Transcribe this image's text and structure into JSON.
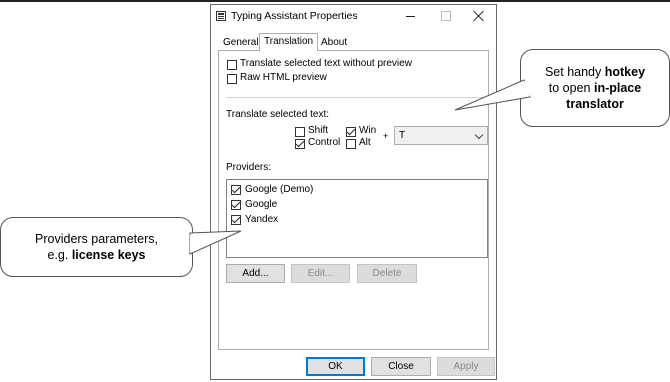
{
  "window": {
    "title": "Typing Assistant Properties",
    "tabs": [
      {
        "label": "General",
        "active": false
      },
      {
        "label": "Translation",
        "active": true
      },
      {
        "label": "About",
        "active": false
      }
    ]
  },
  "options": {
    "translate_without_preview": {
      "label": "Translate selected text without preview",
      "checked": false
    },
    "raw_html_preview": {
      "label": "Raw HTML preview",
      "checked": false
    }
  },
  "hotkey": {
    "section_label": "Translate selected text:",
    "modifiers": [
      {
        "label": "Shift",
        "checked": false
      },
      {
        "label": "Win",
        "checked": true
      },
      {
        "label": "Control",
        "checked": true
      },
      {
        "label": "Alt",
        "checked": false
      }
    ],
    "plus": "+",
    "key_value": "T"
  },
  "providers": {
    "section_label": "Providers:",
    "items": [
      {
        "label": "Google (Demo)",
        "checked": true
      },
      {
        "label": "Google",
        "checked": true
      },
      {
        "label": "Yandex",
        "checked": true
      }
    ],
    "buttons": {
      "add": "Add...",
      "edit": "Edit...",
      "delete": "Delete"
    }
  },
  "footer": {
    "ok": "OK",
    "close": "Close",
    "apply": "Apply"
  },
  "callouts": {
    "hotkey": {
      "line1_pre": "Set handy ",
      "line1_bold": "hotkey",
      "line2_pre": "to open ",
      "line2_bold": "in-place",
      "line3_bold": "translator"
    },
    "providers": {
      "line1": "Providers parameters,",
      "line2_pre": "e.g. ",
      "line2_bold": "license keys"
    }
  },
  "colors": {
    "accent": "#0078d7",
    "border": "#adadad"
  }
}
